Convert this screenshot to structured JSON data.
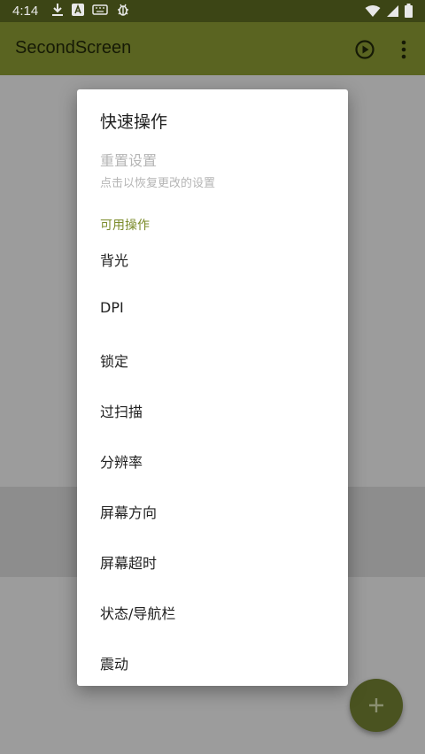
{
  "status_bar": {
    "time": "4:14",
    "icons": [
      "download-icon",
      "font-icon",
      "keyboard-icon",
      "bug-icon"
    ],
    "right_icons": [
      "wifi-icon",
      "signal-icon",
      "battery-icon"
    ]
  },
  "app_bar": {
    "title": "SecondScreen",
    "color": "#5a6421"
  },
  "dialog": {
    "title": "快速操作",
    "reset_title": "重置设置",
    "reset_summary": "点击以恢复更改的设置",
    "category": "可用操作",
    "options": [
      "背光",
      "DPI",
      "锁定",
      "过扫描",
      "分辨率",
      "屏幕方向",
      "屏幕超时",
      "状态/导航栏",
      "震动"
    ]
  },
  "fab": {
    "icon": "plus-icon",
    "color": "#4a5320"
  }
}
